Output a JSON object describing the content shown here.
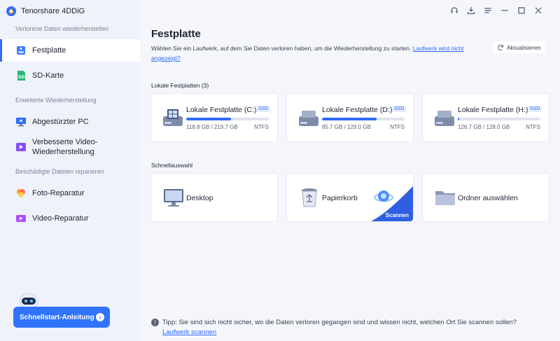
{
  "app": {
    "title": "Tenorshare 4DDiG"
  },
  "sidebar": {
    "sections": [
      {
        "title": "Verlorene Daten wiederherstellen"
      },
      {
        "title": "Erweiterte Wiederherstellung"
      },
      {
        "title": "Beschädigte Dateien reparieren"
      }
    ],
    "items": [
      {
        "label": "Festplatte",
        "icon": "hard-drive-icon"
      },
      {
        "label": "SD-Karte",
        "icon": "sd-card-icon"
      },
      {
        "label": "Abgestürzter PC",
        "icon": "crashed-pc-icon"
      },
      {
        "label_line1": "Verbesserte Video-",
        "label_line2": "Wiederherstellung",
        "icon": "video-recovery-icon"
      },
      {
        "label": "Foto-Reparatur",
        "icon": "photo-repair-icon"
      },
      {
        "label": "Video-Reparatur",
        "icon": "video-repair-icon"
      }
    ],
    "guide_button": "Schnellstart-Anleitung"
  },
  "main": {
    "title": "Festplatte",
    "subtitle": "Wählen Sie ein Laufwerk, auf dem Sie Daten verloren haben, um die Wiederherstellung zu starten.",
    "subtitle_link": "Laufwerk wird nicht angezeigt?",
    "refresh_label": "Aktualisieren",
    "local_title": "Lokale Festplatten (3)",
    "drives": [
      {
        "name": "Lokale Festplatte (C:)",
        "badge": "SSD",
        "size": "118.8 GB / 219.7 GB",
        "fs": "NTFS",
        "used": 0.54
      },
      {
        "name": "Lokale Festplatte (D:)",
        "badge": "SSD",
        "size": "85.7 GB / 129.0 GB",
        "fs": "NTFS",
        "used": 0.66
      },
      {
        "name": "Lokale Festplatte (H:)",
        "badge": "SSD",
        "size": "126.7 GB / 128.0 GB",
        "fs": "NTFS",
        "used": 0.01
      }
    ],
    "quick_title": "Schnellauswahl",
    "quick": [
      {
        "label": "Desktop",
        "icon": "desktop-icon"
      },
      {
        "label": "Papierkorb",
        "icon": "recycle-bin-icon",
        "action": "Scannen"
      },
      {
        "label": "Ordner auswählen",
        "icon": "folder-icon"
      }
    ],
    "tip_text": "Tipp: Sie sind sich nicht sicher, wo die Daten verloren gegangen sind und wissen nicht, welchen Ort Sie scannen sollen?",
    "tip_link": "Laufwerk scannen"
  },
  "colors": {
    "accent": "#2f6bff",
    "sidebar_bg": "#eef2fb",
    "main_bg": "#f4f6fb"
  }
}
